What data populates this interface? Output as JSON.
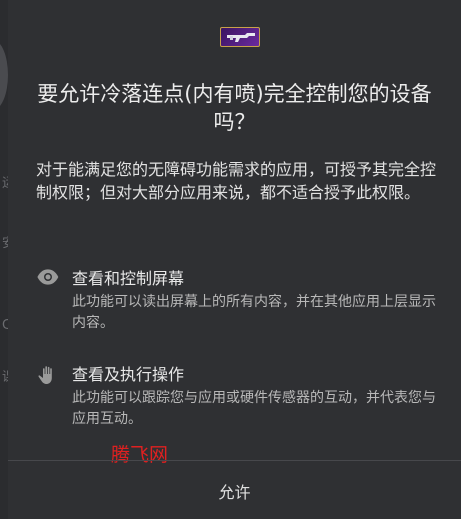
{
  "background": {
    "ghost_chars": [
      "运",
      "安",
      "C",
      "课"
    ]
  },
  "dialog": {
    "app_icon": "rifle-game-app-icon",
    "title": "要允许冷落连点(内有喷)完全控制您的设备吗？",
    "description": "对于能满足您的无障碍功能需求的应用，可授予其完全控制权限；但对大部分应用来说，都不适合授予此权限。",
    "permissions": [
      {
        "icon": "eye-icon",
        "title": "查看和控制屏幕",
        "description": "此功能可以读出屏幕上的所有内容，并在其他应用上层显示内容。"
      },
      {
        "icon": "hand-icon",
        "title": "查看及执行操作",
        "description": "此功能可以跟踪您与应用或硬件传感器的互动，并代表您与应用互动。"
      }
    ],
    "allow_label": "允许"
  },
  "watermark": "腾飞网",
  "colors": {
    "dialog_bg": "#2f3033",
    "text_primary": "#ececec",
    "text_secondary": "#b8b8b8",
    "watermark": "#e02020"
  }
}
